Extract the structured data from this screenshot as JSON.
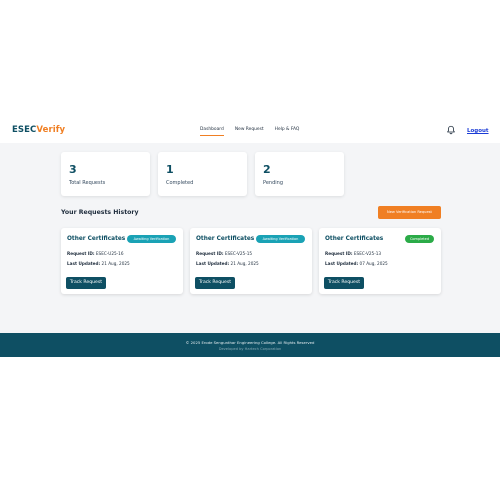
{
  "brand": {
    "part1": "ESEC",
    "part2": "Verify"
  },
  "nav": {
    "items": [
      {
        "label": "Dashboard"
      },
      {
        "label": "New Request"
      },
      {
        "label": "Help & FAQ"
      }
    ],
    "active": "Dashboard",
    "logout": "Logout"
  },
  "stats": [
    {
      "value": "3",
      "label": "Total Requests"
    },
    {
      "value": "1",
      "label": "Completed"
    },
    {
      "value": "2",
      "label": "Pending"
    }
  ],
  "history": {
    "title": "Your Requests History",
    "new_button": "New Verification Request"
  },
  "requests": [
    {
      "title": "Other Certificates",
      "status": "Awaiting Verification",
      "request_label": "Request ID:",
      "request_id": "ESEC-U25-16",
      "updated_label": "Last Updated:",
      "updated": "21 Aug, 2025",
      "button": "Track Request"
    },
    {
      "title": "Other Certificates",
      "status": "Awaiting Verification",
      "request_label": "Request ID:",
      "request_id": "ESEC-V25-15",
      "updated_label": "Last Updated:",
      "updated": "21 Aug, 2025",
      "button": "Track Request"
    },
    {
      "title": "Other Certificates",
      "status": "Completed",
      "request_label": "Request ID:",
      "request_id": "ESEC-V25-13",
      "updated_label": "Last Updated:",
      "updated": "07 Aug, 2025",
      "button": "Track Request"
    }
  ],
  "footer": {
    "copyright": "© 2025 Erode Sengunthar Engineering College. All Rights Reserved",
    "developer": "Developed by Hartech Corporation"
  },
  "colors": {
    "primary": "#0e4f63",
    "accent": "#f07f23",
    "awaiting": "#1aa2b5",
    "completed": "#2bab48",
    "link": "#1a3bd6"
  },
  "icons": {
    "bell": "bell-icon"
  }
}
